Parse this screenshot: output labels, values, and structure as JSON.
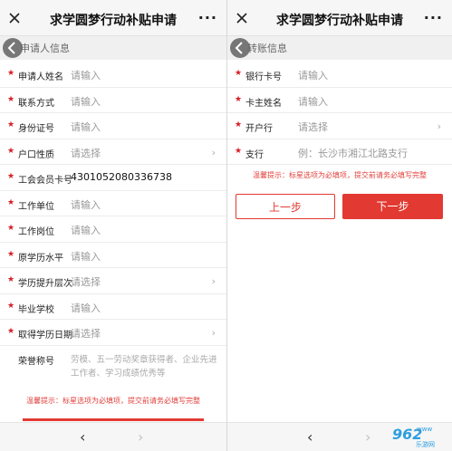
{
  "left": {
    "title": "求学圆梦行动补贴申请",
    "more": "···",
    "section_label": "申请人信息",
    "rows": [
      {
        "required": true,
        "label": "申请人姓名",
        "value": "请输入",
        "filled": false,
        "chevron": false
      },
      {
        "required": true,
        "label": "联系方式",
        "value": "请输入",
        "filled": false,
        "chevron": false
      },
      {
        "required": true,
        "label": "身份证号",
        "value": "请输入",
        "filled": false,
        "chevron": false
      },
      {
        "required": true,
        "label": "户口性质",
        "value": "请选择",
        "filled": false,
        "chevron": true
      },
      {
        "required": true,
        "label": "工会会员卡号",
        "value": "4301052080336738",
        "filled": true,
        "chevron": false
      },
      {
        "required": true,
        "label": "工作单位",
        "value": "请输入",
        "filled": false,
        "chevron": false
      },
      {
        "required": true,
        "label": "工作岗位",
        "value": "请输入",
        "filled": false,
        "chevron": false
      },
      {
        "required": true,
        "label": "原学历水平",
        "value": "请输入",
        "filled": false,
        "chevron": false
      },
      {
        "required": true,
        "label": "学历提升层次",
        "value": "请选择",
        "filled": false,
        "chevron": true
      },
      {
        "required": true,
        "label": "毕业学校",
        "value": "请输入",
        "filled": false,
        "chevron": false
      },
      {
        "required": true,
        "label": "取得学历日期",
        "value": "请选择",
        "filled": false,
        "chevron": true
      }
    ],
    "honor_label": "荣誉称号",
    "honor_placeholder": "劳模、五一劳动奖章获得者、企业先进工作者、学习成绩优秀等",
    "tip": "温馨提示：标星选项为必填项，提交前请务必填写完整",
    "nav_prev": "‹",
    "nav_next": "›"
  },
  "right": {
    "title": "求学圆梦行动补贴申请",
    "more": "···",
    "section_label": "转账信息",
    "rows": [
      {
        "required": true,
        "label": "银行卡号",
        "value": "请输入",
        "filled": false,
        "chevron": false
      },
      {
        "required": true,
        "label": "卡主姓名",
        "value": "请输入",
        "filled": false,
        "chevron": false
      },
      {
        "required": true,
        "label": "开户行",
        "value": "请选择",
        "filled": false,
        "chevron": true
      },
      {
        "required": true,
        "label": "支行",
        "value": "例：长沙市湘江北路支行",
        "filled": false,
        "chevron": false
      }
    ],
    "tip": "温馨提示：标星选项为必填项，提交前请务必填写完整",
    "prev_step": "上一步",
    "next_step": "下一步",
    "nav_prev": "‹",
    "nav_next": "›",
    "watermark_logo": "962",
    "watermark_www": "www",
    "watermark_sub": "乐游网"
  },
  "colors": {
    "accent": "#e23a32",
    "star": "#d71f26",
    "placeholder": "#999999"
  }
}
